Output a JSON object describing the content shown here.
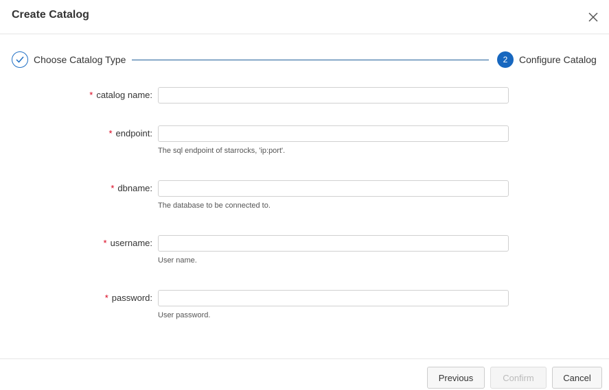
{
  "dialog": {
    "title": "Create Catalog",
    "close_icon": "close-icon"
  },
  "steps": [
    {
      "label": "Choose Catalog Type",
      "status": "completed",
      "icon": "check-icon"
    },
    {
      "number": "2",
      "label": "Configure Catalog",
      "status": "active"
    }
  ],
  "form": {
    "required_mark": "*",
    "fields": [
      {
        "label": "catalog name:",
        "value": "",
        "help": ""
      },
      {
        "label": "endpoint:",
        "value": "",
        "help": "The sql endpoint of starrocks, 'ip:port'."
      },
      {
        "label": "dbname:",
        "value": "",
        "help": "The database to be connected to."
      },
      {
        "label": "username:",
        "value": "",
        "help": "User name."
      },
      {
        "label": "password:",
        "value": "",
        "help": "User password."
      }
    ]
  },
  "footer": {
    "previous_label": "Previous",
    "confirm_label": "Confirm",
    "confirm_disabled": true,
    "cancel_label": "Cancel"
  },
  "colors": {
    "accent": "#1767bf",
    "required": "#d9001b"
  }
}
